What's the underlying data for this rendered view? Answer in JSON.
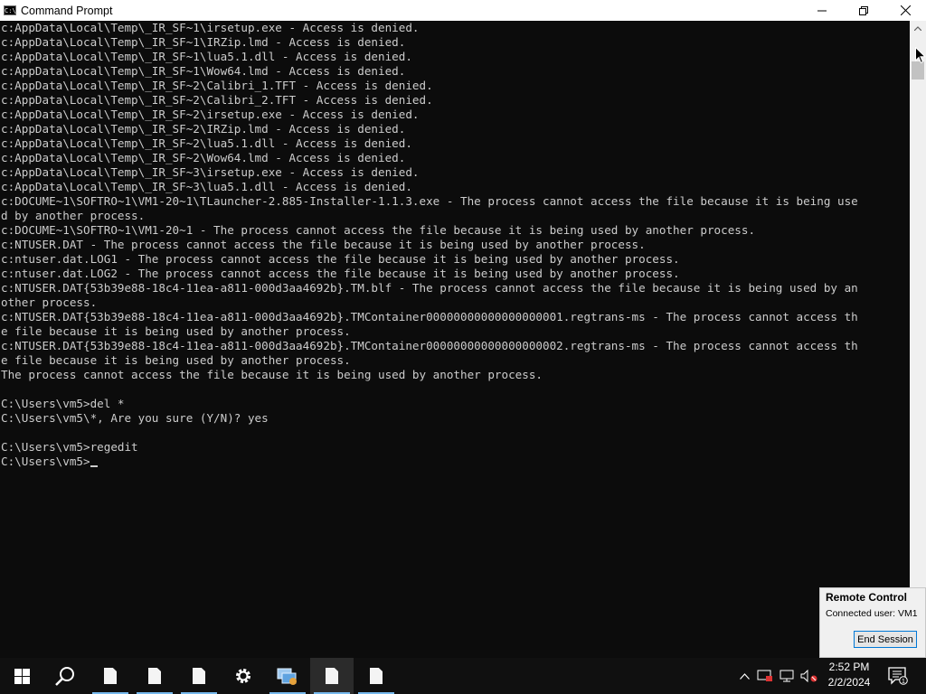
{
  "window": {
    "title": "Command Prompt",
    "icon_name": "cmd-icon",
    "controls": [
      "minimize-icon",
      "restore-icon",
      "close-icon"
    ]
  },
  "console": {
    "lines": [
      "c:AppData\\Local\\Temp\\_IR_SF~1\\irsetup.exe - Access is denied.",
      "c:AppData\\Local\\Temp\\_IR_SF~1\\IRZip.lmd - Access is denied.",
      "c:AppData\\Local\\Temp\\_IR_SF~1\\lua5.1.dll - Access is denied.",
      "c:AppData\\Local\\Temp\\_IR_SF~1\\Wow64.lmd - Access is denied.",
      "c:AppData\\Local\\Temp\\_IR_SF~2\\Calibri_1.TFT - Access is denied.",
      "c:AppData\\Local\\Temp\\_IR_SF~2\\Calibri_2.TFT - Access is denied.",
      "c:AppData\\Local\\Temp\\_IR_SF~2\\irsetup.exe - Access is denied.",
      "c:AppData\\Local\\Temp\\_IR_SF~2\\IRZip.lmd - Access is denied.",
      "c:AppData\\Local\\Temp\\_IR_SF~2\\lua5.1.dll - Access is denied.",
      "c:AppData\\Local\\Temp\\_IR_SF~2\\Wow64.lmd - Access is denied.",
      "c:AppData\\Local\\Temp\\_IR_SF~3\\irsetup.exe - Access is denied.",
      "c:AppData\\Local\\Temp\\_IR_SF~3\\lua5.1.dll - Access is denied.",
      "c:DOCUME~1\\SOFTRO~1\\VM1-20~1\\TLauncher-2.885-Installer-1.1.3.exe - The process cannot access the file because it is being use",
      "d by another process.",
      "c:DOCUME~1\\SOFTRO~1\\VM1-20~1 - The process cannot access the file because it is being used by another process.",
      "c:NTUSER.DAT - The process cannot access the file because it is being used by another process.",
      "c:ntuser.dat.LOG1 - The process cannot access the file because it is being used by another process.",
      "c:ntuser.dat.LOG2 - The process cannot access the file because it is being used by another process.",
      "c:NTUSER.DAT{53b39e88-18c4-11ea-a811-000d3aa4692b}.TM.blf - The process cannot access the file because it is being used by an",
      "other process.",
      "c:NTUSER.DAT{53b39e88-18c4-11ea-a811-000d3aa4692b}.TMContainer00000000000000000001.regtrans-ms - The process cannot access th",
      "e file because it is being used by another process.",
      "c:NTUSER.DAT{53b39e88-18c4-11ea-a811-000d3aa4692b}.TMContainer00000000000000000002.regtrans-ms - The process cannot access th",
      "e file because it is being used by another process.",
      "The process cannot access the file because it is being used by another process.",
      "",
      "C:\\Users\\vm5>del *",
      "C:\\Users\\vm5\\*, Are you sure (Y/N)? yes",
      "",
      "C:\\Users\\vm5>regedit",
      ""
    ],
    "prompt": "C:\\Users\\vm5>"
  },
  "remote_control": {
    "title": "Remote Control",
    "connected_user": "Connected user: VM1",
    "end_button": "End Session"
  },
  "taskbar": {
    "items": [
      {
        "icon": "start-windows-icon"
      },
      {
        "icon": "search-icon"
      },
      {
        "icon": "document-icon",
        "running": true
      },
      {
        "icon": "document-icon",
        "running": true
      },
      {
        "icon": "document-icon",
        "running": true
      },
      {
        "icon": "settings-gear-icon"
      },
      {
        "icon": "network-app-icon",
        "running": true
      },
      {
        "icon": "document-icon",
        "running": true,
        "active": true
      },
      {
        "icon": "document-icon",
        "running": true
      }
    ],
    "tray": {
      "time": "2:52 PM",
      "date": "2/2/2024",
      "notification_count": "1"
    }
  },
  "colors": {
    "console_bg": "#0c0c0c",
    "console_fg": "#cccccc",
    "taskbar_bg": "#101010",
    "accent": "#76b9ed"
  }
}
